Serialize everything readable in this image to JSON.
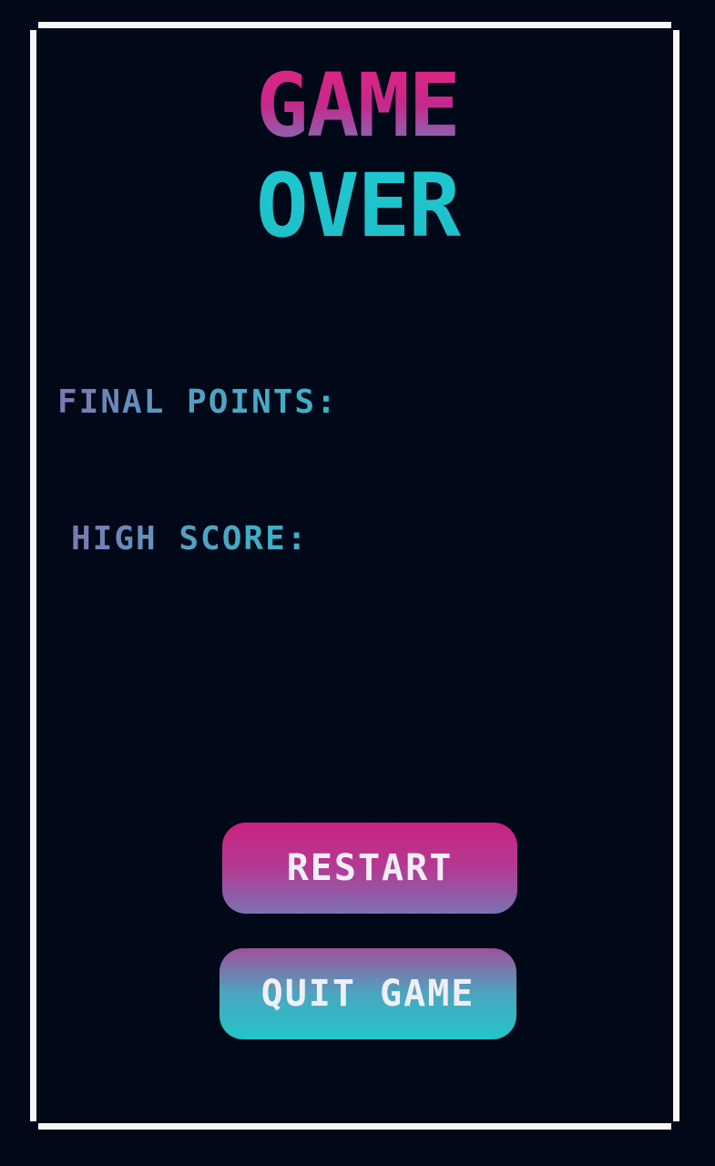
{
  "screen": {
    "title_line1": "GAME",
    "title_line2": "OVER"
  },
  "stats": {
    "final_points_label": "FINAL POINTS:",
    "high_score_label": "HIGH SCORE:"
  },
  "buttons": {
    "restart_label": "RESTART",
    "quit_label": "QUIT GAME"
  },
  "colors": {
    "background": "#010817",
    "frame": "#f4f6f8",
    "pink": "#c9237f",
    "purple": "#7a78b7",
    "cyan": "#1fc7cf",
    "button_text": "#f1eef6"
  }
}
